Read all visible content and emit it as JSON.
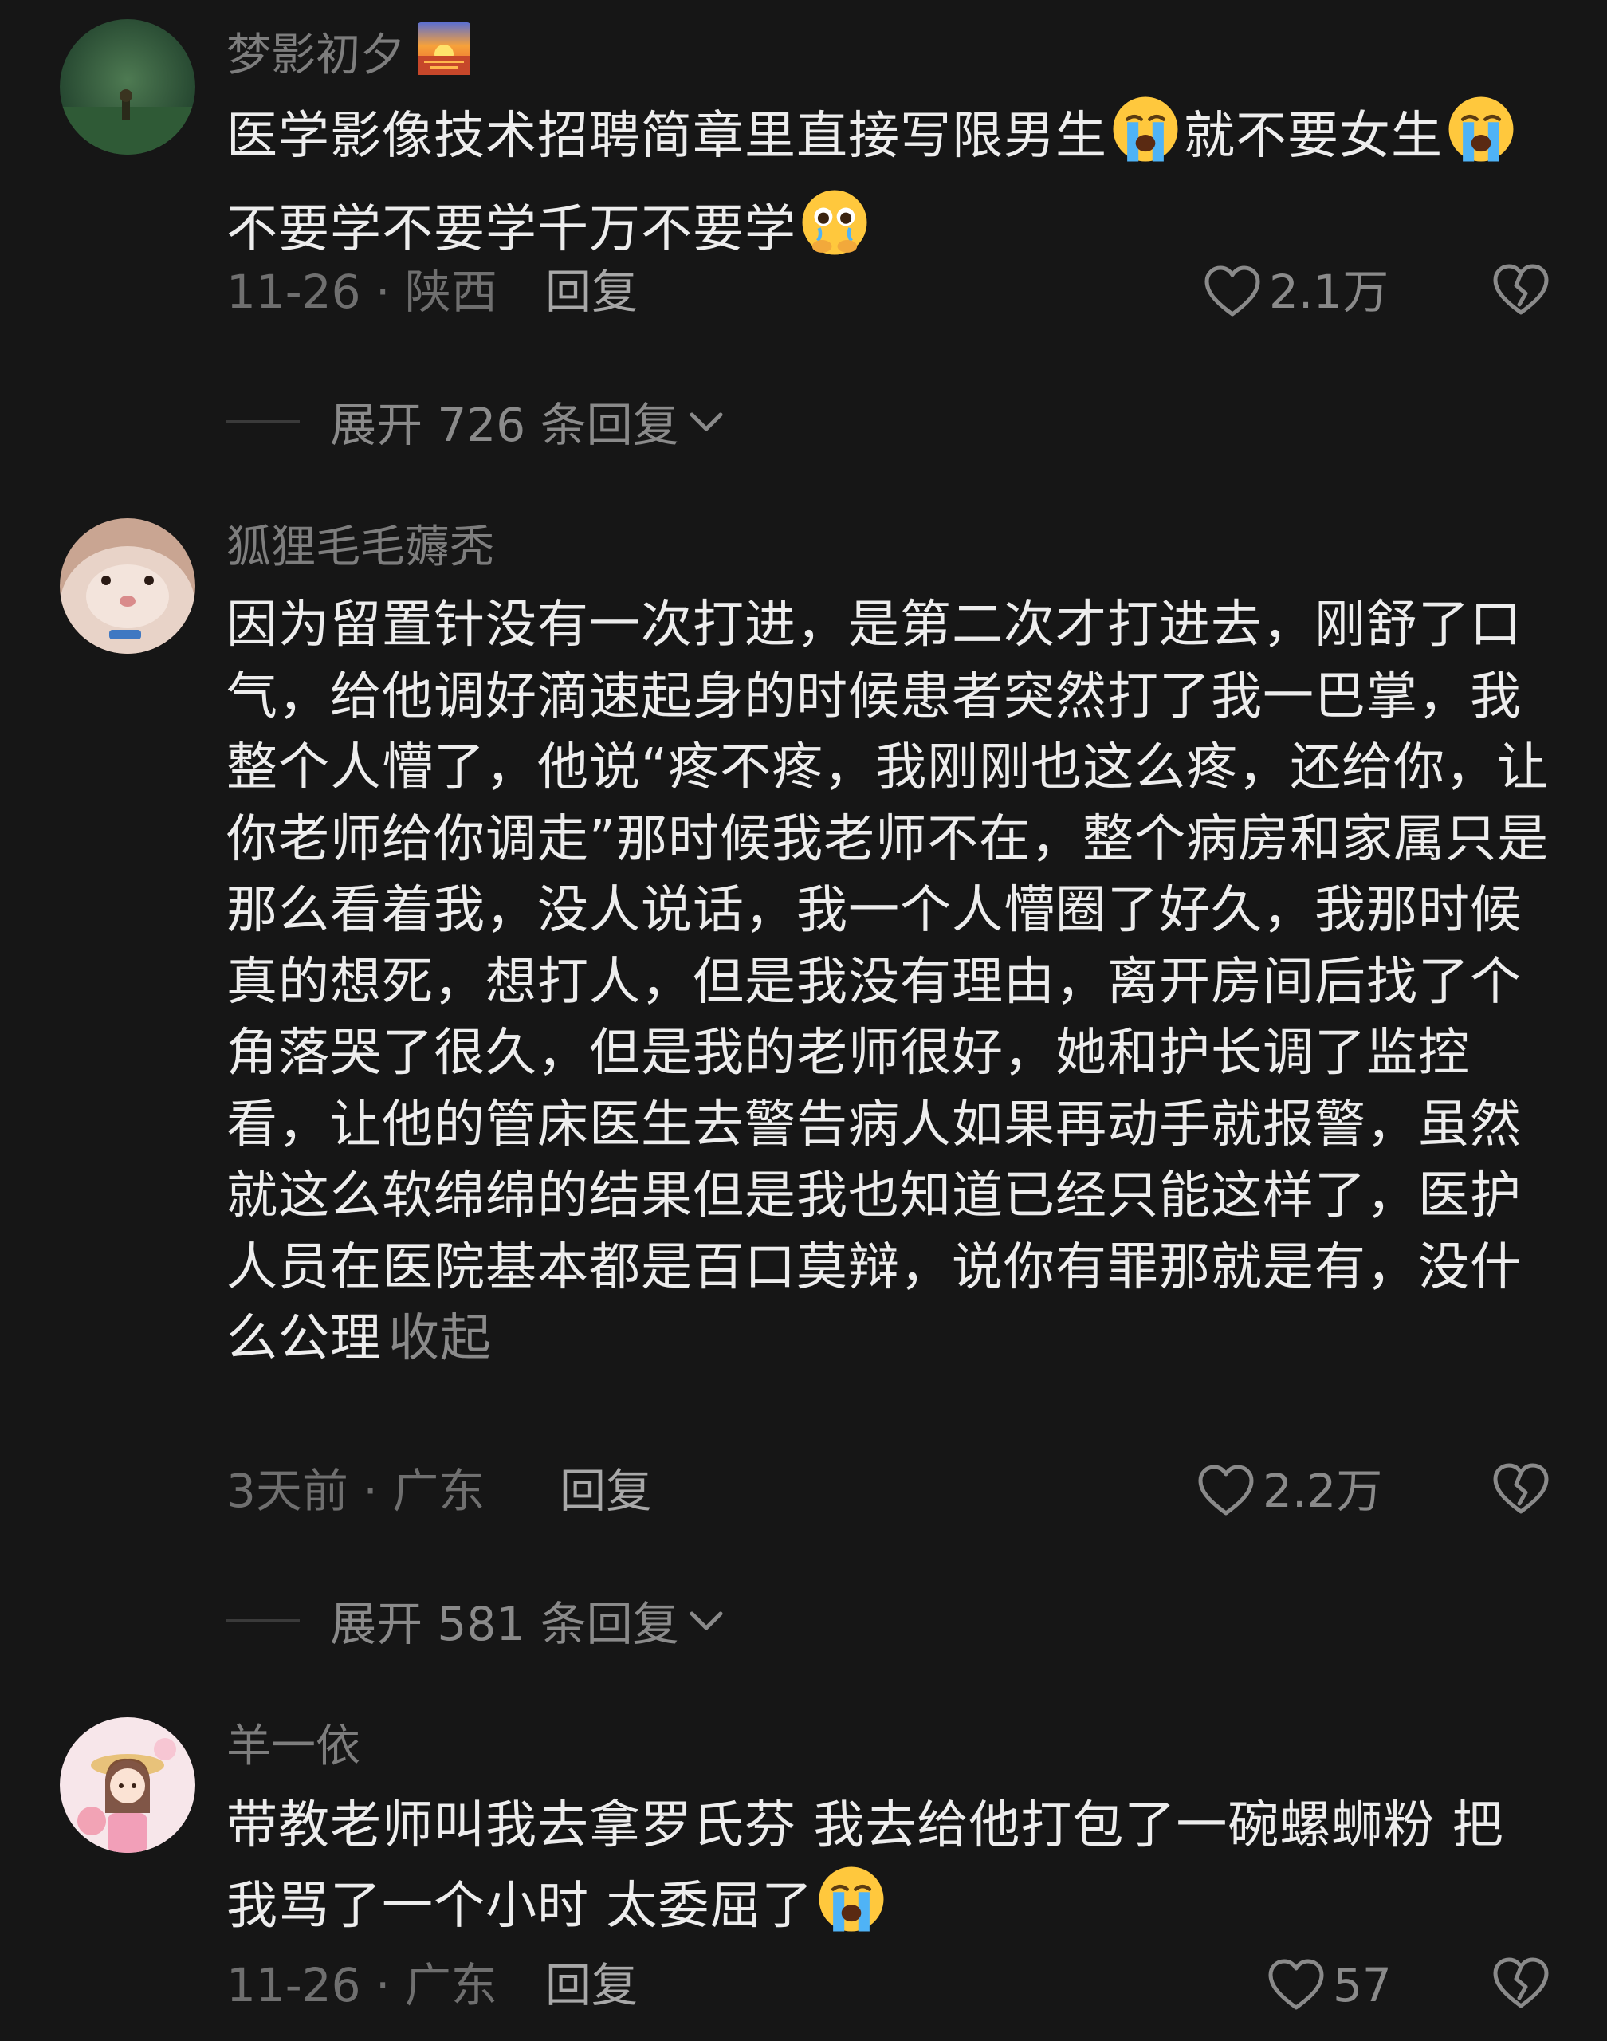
{
  "comments": [
    {
      "username": "梦影初夕",
      "username_icon": "sunset-icon",
      "text": {
        "part1": "医学影像技术招聘简章里直接写限男生",
        "emoji1": "loudly-crying-emoji",
        "part2": "就不要女生",
        "emoji2": "loudly-crying-emoji",
        "part3": " 不要学不要学千万不要学",
        "emoji3": "holding-back-tears-emoji"
      },
      "date": "11-26 · 陕西",
      "reply_label": "回复",
      "likes": "2.1万",
      "expand_label": "展开 726 条回复"
    },
    {
      "username": "狐狸毛毛薅秃",
      "text": {
        "part1": "因为留置针没有一次打进，是第二次才打进去，刚舒了口气，给他调好滴速起身的时候患者突然打了我一巴掌，我整个人懵了，他说“疼不疼，我刚刚也这么疼，还给你，让你老师给你调走”那时候我老师不在，整个病房和家属只是那么看着我，没人说话，我一个人懵圈了好久，我那时候真的想死，想打人，但是我没有理由，离开房间后找了个角落哭了很久，但是我的老师很好，她和护长调了监控看，让他的管床医生去警告病人如果再动手就报警，虽然就这么软绵绵的结果但是我也知道已经只能这样了，医护人员在医院基本都是百口莫辩，说你有罪那就是有，没什么公理"
      },
      "collapse_label": "收起",
      "date": "3天前 · 广东",
      "reply_label": "回复",
      "likes": "2.2万",
      "expand_label": "展开 581 条回复"
    },
    {
      "username": "羊一依",
      "text": {
        "part1": "带教老师叫我去拿罗氏芬 我去给他打包了一碗螺蛳粉 把我骂了一个小时 太委屈了",
        "emoji1": "loudly-crying-emoji"
      },
      "date": "11-26 · 广东",
      "reply_label": "回复",
      "likes": "57"
    }
  ],
  "colors": {
    "background": "#161616",
    "text_primary": "#ededed",
    "text_secondary": "#7d7d7d",
    "reply_label": "#a8a8a8",
    "emoji_face": "#ffc83d",
    "tear": "#4fb3f6"
  }
}
